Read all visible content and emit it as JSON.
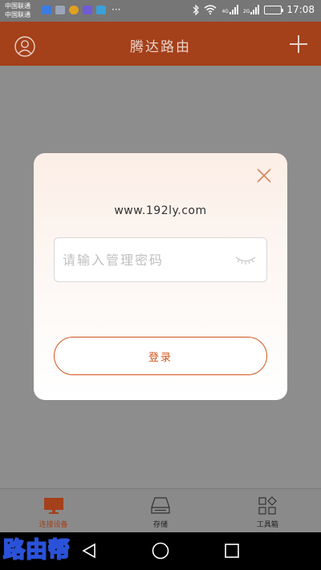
{
  "status_bar": {
    "carrier_1": "中国联通",
    "carrier_2": "中国联通",
    "more_indicator": "···",
    "network_1": "4G",
    "network_2": "2G",
    "time": "17:08",
    "battery_level": 0.8,
    "app_icon_colors": [
      "#3d7be0",
      "#9aa6b8",
      "#e0a020",
      "#6e5bd6",
      "#3aa0d8"
    ]
  },
  "header": {
    "title": "腾达路由",
    "left_icon": "user-circle-icon",
    "right_icon": "plus-icon",
    "background": "#a4401a"
  },
  "login_dialog": {
    "host": "www.192ly.com",
    "password_placeholder": "请输入管理密码",
    "password_value": "",
    "eye_icon": "eye-closed-icon",
    "close_icon": "close-icon",
    "login_label": "登录",
    "accent": "#d4541e"
  },
  "tabbar": {
    "tabs": [
      {
        "label": "连接设备",
        "icon": "monitor-icon",
        "active": true
      },
      {
        "label": "存储",
        "icon": "storage-icon",
        "active": false
      },
      {
        "label": "工具箱",
        "icon": "toolbox-icon",
        "active": false
      }
    ]
  },
  "system_nav": {
    "watermark": "路由帮",
    "back_icon": "back-triangle-icon",
    "home_icon": "home-circle-icon",
    "recents_icon": "recents-square-icon"
  }
}
